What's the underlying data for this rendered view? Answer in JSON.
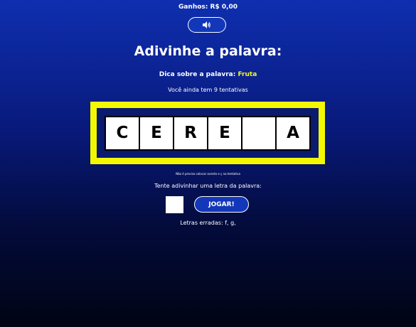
{
  "header": {
    "earnings_label": "Ganhos:",
    "earnings_value": "R$ 0,00"
  },
  "sound_button": {
    "icon": "speaker-icon"
  },
  "title": "Adivinhe a palavra:",
  "hint": {
    "label": "Dica sobre a palavra:",
    "value": "Fruta"
  },
  "attempts_text": "Você ainda tem 9 tentativas",
  "board": {
    "border_color": "#f3f800",
    "letters": [
      "C",
      "E",
      "R",
      "E",
      "",
      "A"
    ]
  },
  "note": "Não é preciso colocar acento e ç na tentativa",
  "prompt": "Tente adivinhar uma letra da palavra:",
  "guess_input": {
    "value": ""
  },
  "play_button": "JOGAR!",
  "wrong_letters": {
    "label": "Letras erradas:",
    "value": "f, g,"
  },
  "colors": {
    "accent_yellow": "#f3f32b",
    "button_blue": "#1337b9"
  }
}
